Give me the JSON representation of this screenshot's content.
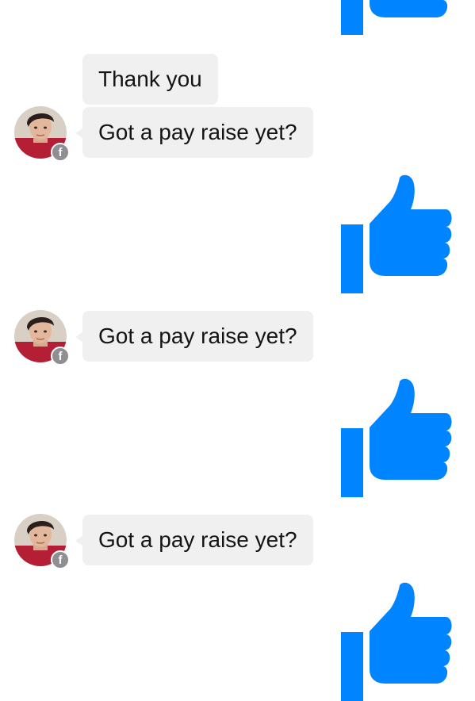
{
  "thread": {
    "accent_color": "#0084ff",
    "bubble_color": "#f1f0f0",
    "messages": [
      {
        "type": "like",
        "sender": "self"
      },
      {
        "type": "text",
        "sender": "contact",
        "text": "Thank you"
      },
      {
        "type": "text",
        "sender": "contact",
        "text": "Got a pay raise yet?"
      },
      {
        "type": "like",
        "sender": "self"
      },
      {
        "type": "text",
        "sender": "contact",
        "text": "Got a pay raise yet?"
      },
      {
        "type": "like",
        "sender": "self"
      },
      {
        "type": "text",
        "sender": "contact",
        "text": "Got a pay raise yet?"
      },
      {
        "type": "like",
        "sender": "self"
      }
    ],
    "avatar_badge_icon": "facebook-icon",
    "avatar_badge_glyph": "f",
    "like_icon": "thumbs-up-icon"
  }
}
